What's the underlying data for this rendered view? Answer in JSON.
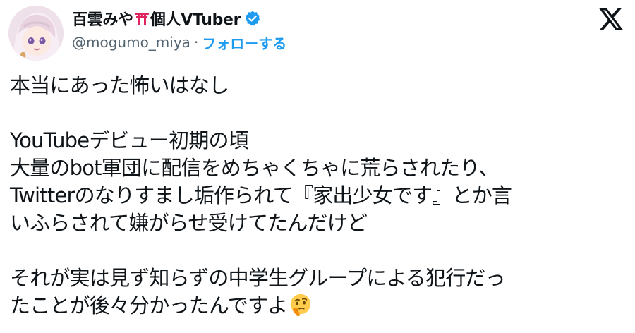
{
  "author": {
    "display_name_part1": "百雲みや",
    "display_name_part2": "個人VTuber",
    "torii_icon": "torii-gate-emoji",
    "verified_icon": "verified-badge-icon",
    "handle": "@mogumo_miya",
    "separator": "·",
    "follow_label": "フォローする"
  },
  "platform_icon": "x-logo-icon",
  "tweet": {
    "lines": [
      "本当にあった怖いはなし",
      "",
      "YouTubeデビュー初期の頃",
      "大量のbot軍団に配信をめちゃくちゃに荒らされたり、",
      "Twitterのなりすまし垢作られて『家出少女です』とか言",
      "いふらされて嫌がらせ受けてたんだけど",
      "",
      "それが実は見ず知らずの中学生グループによる犯行だっ",
      "たことが後々分かったんですよ"
    ],
    "trailing_emoji": "thinking-face-emoji"
  },
  "colors": {
    "link_blue": "#1d9bf0",
    "verified_blue": "#1d9bf0",
    "secondary_text": "#536471",
    "primary_text": "#0f1419",
    "torii_red": "#e0245e"
  }
}
